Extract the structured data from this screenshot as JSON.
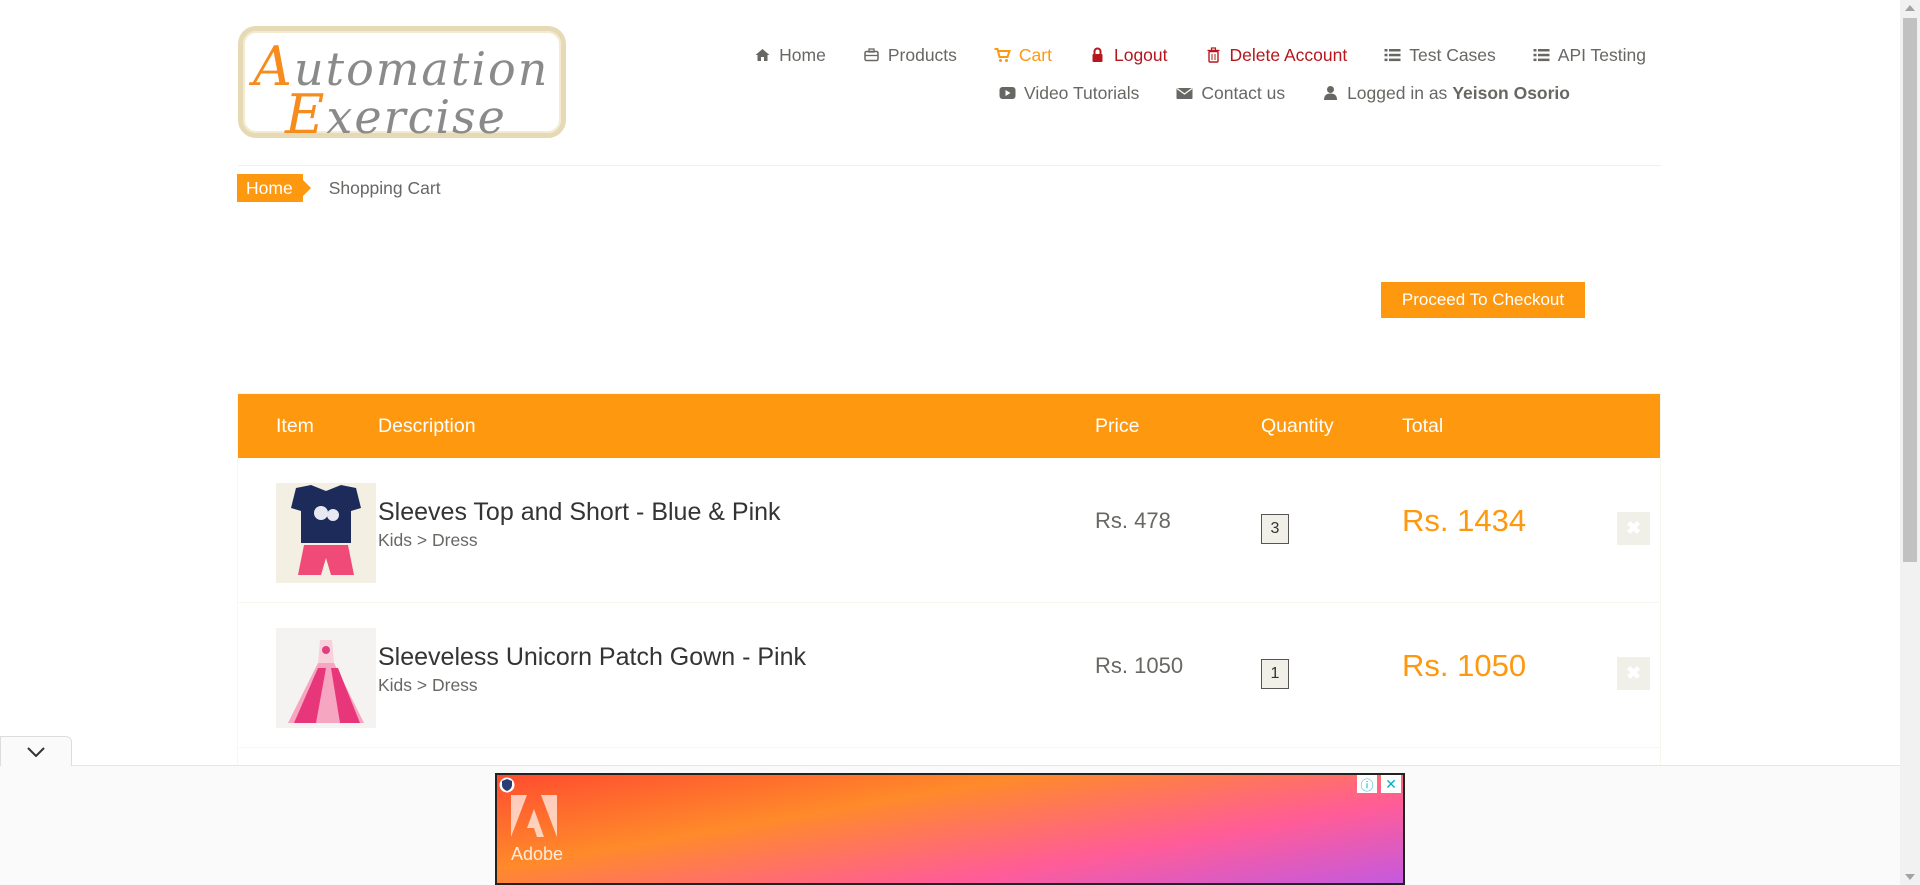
{
  "logo": {
    "line1_first": "A",
    "line1_rest": "utomation",
    "line2_first": "E",
    "line2_rest": "xercise"
  },
  "nav": {
    "row1": [
      {
        "label": "Home",
        "icon": "home-icon"
      },
      {
        "label": "Products",
        "icon": "briefcase-icon"
      },
      {
        "label": "Cart",
        "icon": "cart-icon"
      },
      {
        "label": "Logout",
        "icon": "lock-icon"
      },
      {
        "label": "Delete Account",
        "icon": "trash-icon"
      },
      {
        "label": "Test Cases",
        "icon": "list-icon"
      },
      {
        "label": "API Testing",
        "icon": "list-icon"
      }
    ],
    "row2": [
      {
        "label": "Video Tutorials",
        "icon": "youtube-play-icon"
      },
      {
        "label": "Contact us",
        "icon": "envelope-icon"
      },
      {
        "label": "Logged in as",
        "user": "Yeison Osorio",
        "icon": "user-icon"
      }
    ]
  },
  "breadcrumb": {
    "home": "Home",
    "current": "Shopping Cart"
  },
  "checkout_button": "Proceed To Checkout",
  "cart": {
    "headers": {
      "item": "Item",
      "description": "Description",
      "price": "Price",
      "quantity": "Quantity",
      "total": "Total"
    },
    "rows": [
      {
        "name": "Sleeves Top and Short - Blue & Pink",
        "category": "Kids > Dress",
        "price": "Rs. 478",
        "quantity": "3",
        "total": "Rs. 1434"
      },
      {
        "name": "Sleeveless Unicorn Patch Gown - Pink",
        "category": "Kids > Dress",
        "price": "Rs. 1050",
        "quantity": "1",
        "total": "Rs. 1050"
      }
    ]
  },
  "ad": {
    "brand": "Adobe",
    "info": "ⓘ",
    "close": "✕"
  },
  "colors": {
    "accent": "#fe980f",
    "danger": "#b5171d",
    "text": "#696763"
  }
}
